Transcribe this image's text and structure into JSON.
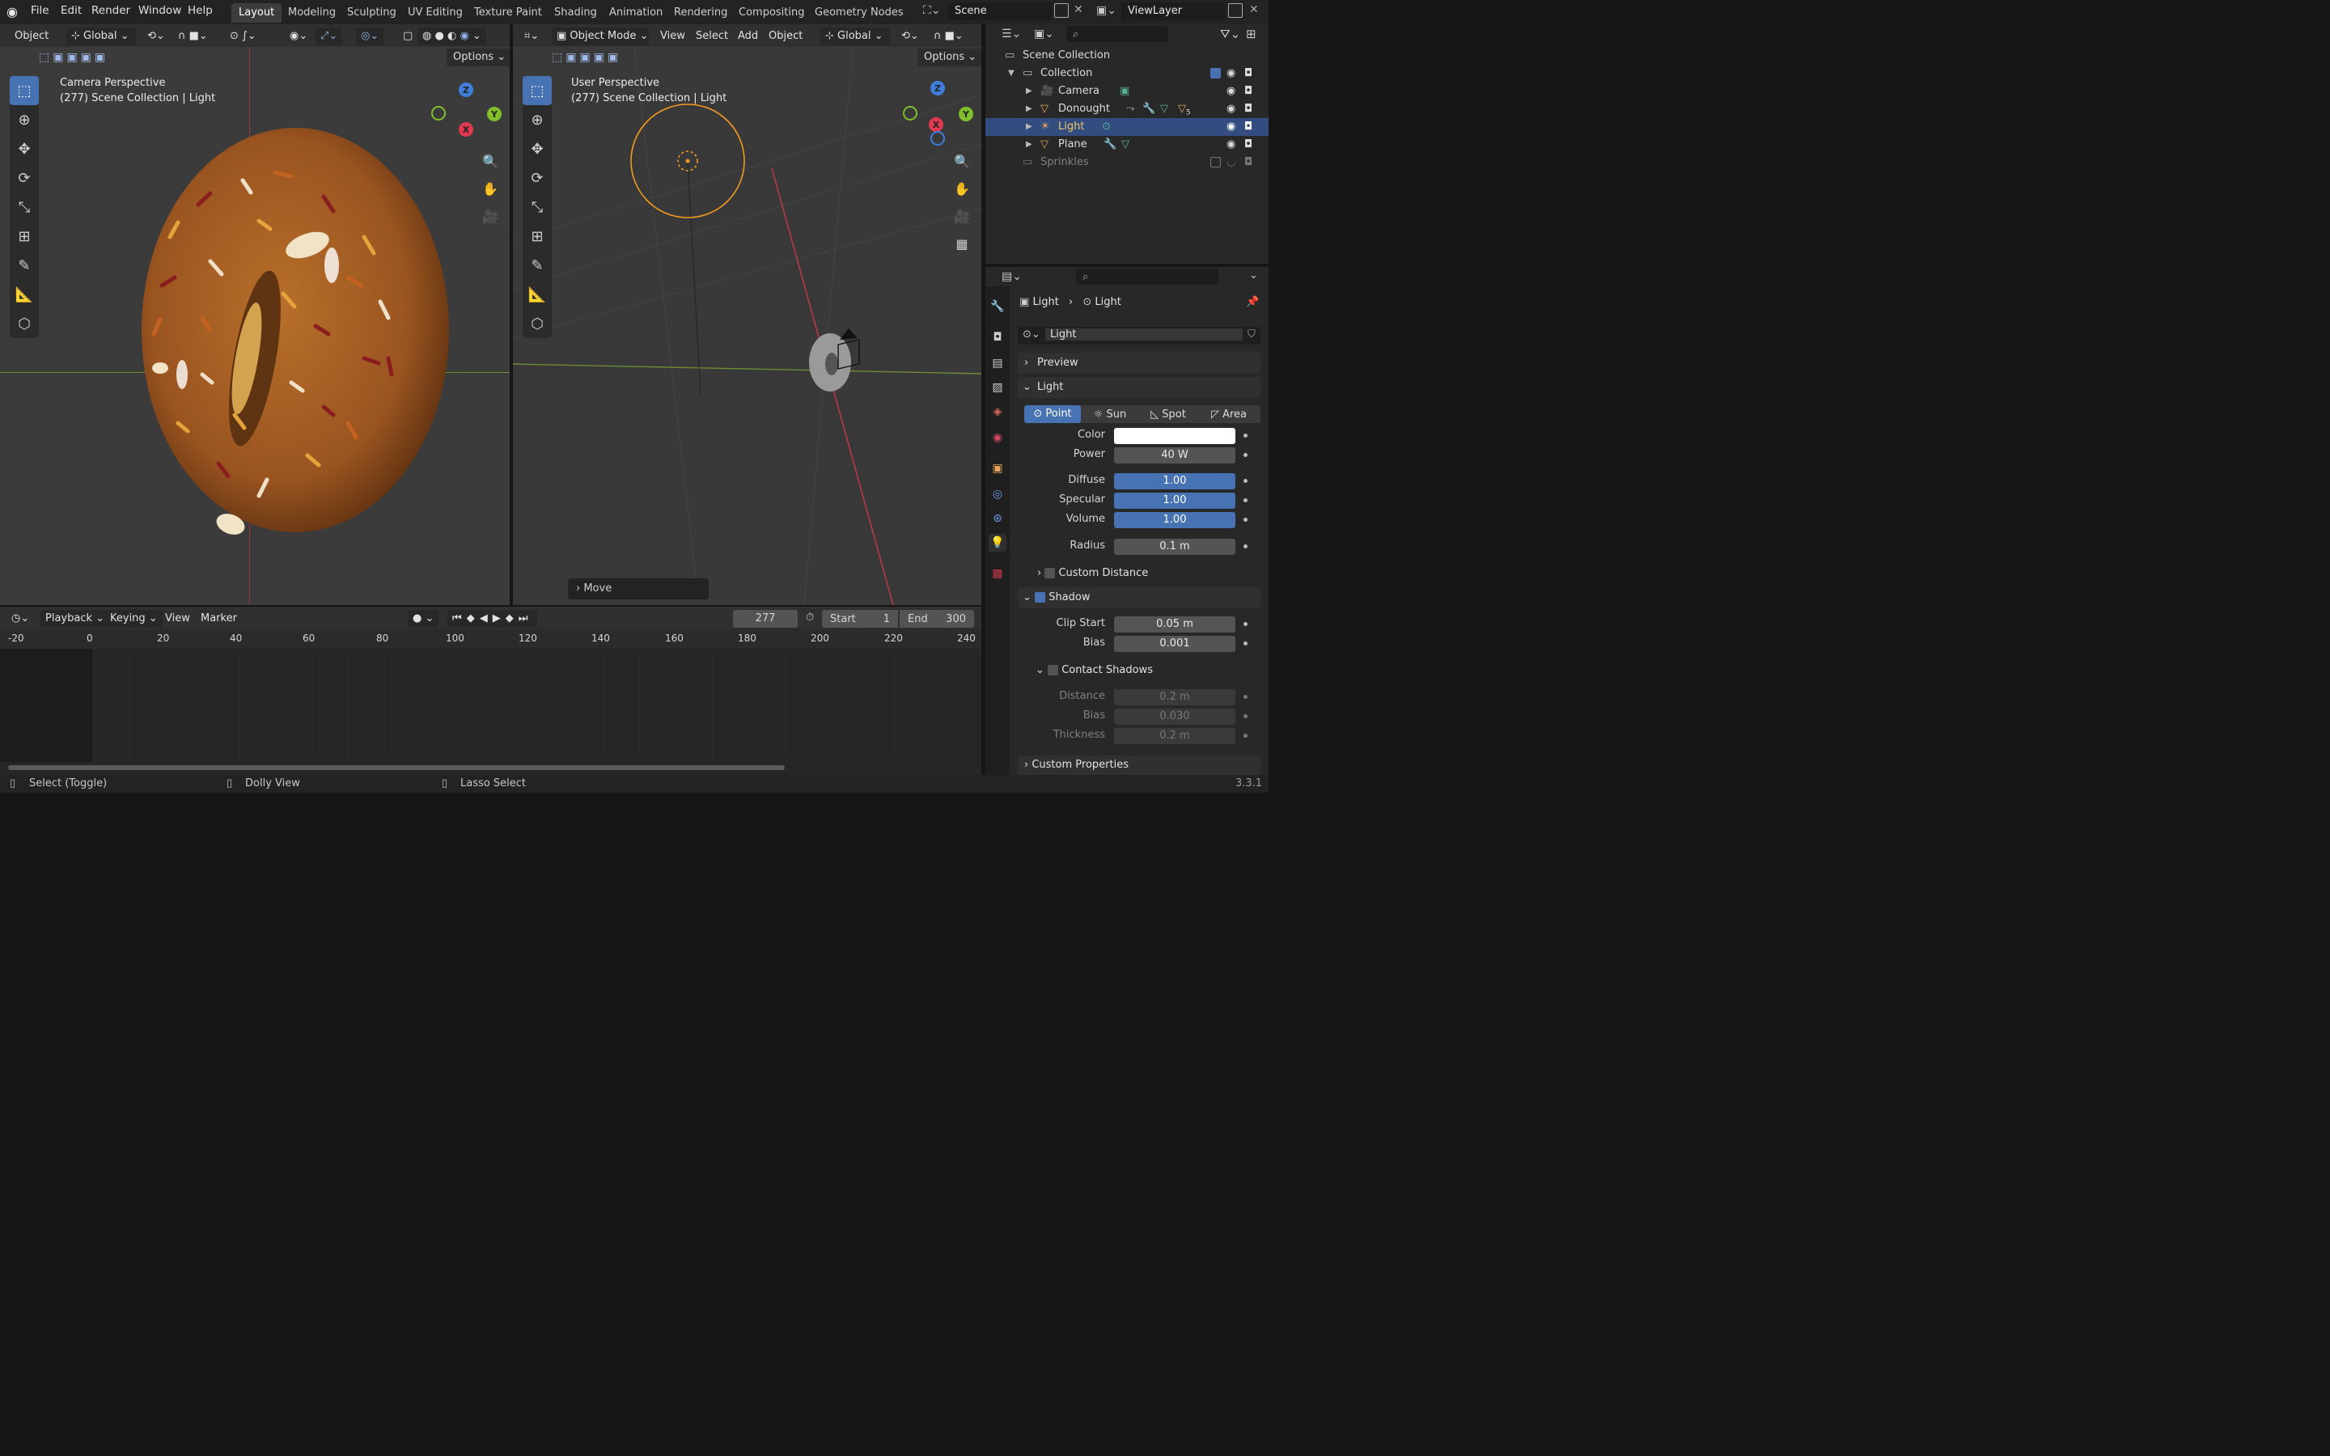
{
  "menubar": {
    "file": "File",
    "edit": "Edit",
    "render": "Render",
    "window": "Window",
    "help": "Help"
  },
  "workspaces": [
    "Layout",
    "Modeling",
    "Sculpting",
    "UV Editing",
    "Texture Paint",
    "Shading",
    "Animation",
    "Rendering",
    "Compositing",
    "Geometry Nodes"
  ],
  "active_workspace": "Layout",
  "scene": {
    "name": "Scene",
    "view_layer": "ViewLayer"
  },
  "left_viewport": {
    "header": {
      "object": "Object",
      "orientation": "Global",
      "options": "Options"
    },
    "title": "Camera Perspective",
    "subtitle": "(277) Scene Collection | Light"
  },
  "right_viewport": {
    "header": {
      "mode": "Object Mode",
      "view": "View",
      "select": "Select",
      "add": "Add",
      "object": "Object",
      "orientation": "Global",
      "options": "Options"
    },
    "title": "User Perspective",
    "subtitle": "(277) Scene Collection | Light",
    "operator_panel": "Move"
  },
  "gizmo": {
    "z": "Z",
    "y": "Y",
    "x": "X"
  },
  "outliner": {
    "search_placeholder": "",
    "root": "Scene Collection",
    "items": [
      {
        "label": "Collection",
        "depth": 1
      },
      {
        "label": "Camera",
        "depth": 2
      },
      {
        "label": "Donought",
        "depth": 2,
        "modifier_count": "5"
      },
      {
        "label": "Light",
        "depth": 2,
        "selected": true
      },
      {
        "label": "Plane",
        "depth": 2
      },
      {
        "label": "Sprinkles",
        "depth": 1,
        "disabled": true
      }
    ]
  },
  "properties": {
    "breadcrumb": [
      "Light",
      "Light"
    ],
    "datablock": "Light",
    "preview": "Preview",
    "light_panel": "Light",
    "light_types": [
      "Point",
      "Sun",
      "Spot",
      "Area"
    ],
    "active_light_type": "Point",
    "color_label": "Color",
    "color_value": "#ffffff",
    "power_label": "Power",
    "power": "40 W",
    "diffuse_label": "Diffuse",
    "diffuse": "1.00",
    "specular_label": "Specular",
    "specular": "1.00",
    "volume_label": "Volume",
    "volume": "1.00",
    "radius_label": "Radius",
    "radius": "0.1 m",
    "custom_distance": "Custom Distance",
    "shadow": "Shadow",
    "clip_start_label": "Clip Start",
    "clip_start": "0.05 m",
    "bias_label": "Bias",
    "bias": "0.001",
    "contact_shadows": "Contact Shadows",
    "distance_label": "Distance",
    "cs_distance": "0.2 m",
    "cs_bias_label": "Bias",
    "cs_bias": "0.030",
    "thickness_label": "Thickness",
    "cs_thickness": "0.2 m",
    "custom_properties": "Custom Properties"
  },
  "timeline": {
    "playback": "Playback",
    "keying": "Keying",
    "view": "View",
    "marker": "Marker",
    "current_frame": "277",
    "start_label": "Start",
    "start": "1",
    "end_label": "End",
    "end": "300",
    "ruler": [
      "-20",
      "0",
      "20",
      "40",
      "60",
      "80",
      "100",
      "120",
      "140",
      "160",
      "180",
      "200",
      "220",
      "240"
    ]
  },
  "statusbar": {
    "select": "Select (Toggle)",
    "dolly": "Dolly View",
    "lasso": "Lasso Select",
    "version": "3.3.1"
  },
  "colors": {
    "accent": "#4772b3",
    "selection": "#334d80",
    "light_ring": "#f39a1f",
    "x_axis": "#e0394f",
    "y_axis": "#7fbf2a",
    "z_axis": "#3f7fdb"
  }
}
